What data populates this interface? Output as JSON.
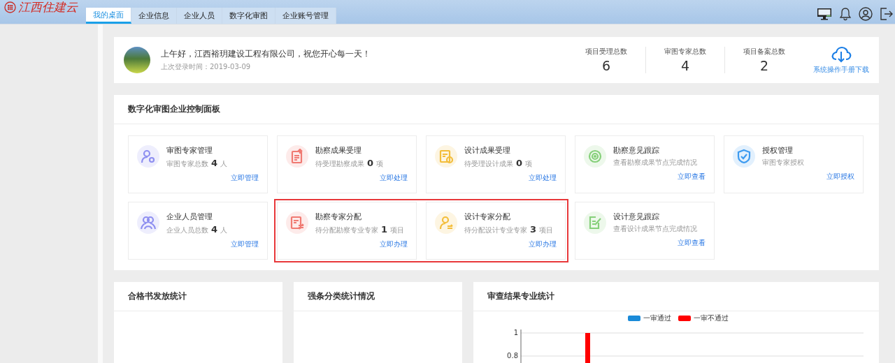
{
  "header": {
    "logo": "江西住建云",
    "tabs": [
      {
        "label": "我的桌面",
        "selected": true
      },
      {
        "label": "企业信息",
        "selected": false
      },
      {
        "label": "企业人员",
        "selected": false
      },
      {
        "label": "数字化审图",
        "selected": false
      },
      {
        "label": "企业账号管理",
        "selected": false
      }
    ]
  },
  "welcome": {
    "greeting": "上午好，江西裕玥建设工程有限公司，祝您开心每一天！",
    "last_login": "上次登录时间：2019-03-09",
    "stats": [
      {
        "label": "项目受理总数",
        "value": "6"
      },
      {
        "label": "审图专家总数",
        "value": "4"
      },
      {
        "label": "项目备案总数",
        "value": "2"
      }
    ],
    "download": "系统操作手册下载"
  },
  "control_panel": {
    "title": "数字化审图企业控制面板",
    "rows": [
      [
        {
          "kind": "person-gear",
          "color": "#8e8ff0",
          "title": "审图专家管理",
          "subtitle": "审图专家总数",
          "count": "4",
          "unit": "人",
          "action": "立即管理",
          "highlighted": false
        },
        {
          "kind": "doc-up",
          "color": "#f07a72",
          "title": "勘察成果受理",
          "subtitle": "待受理勘察成果",
          "count": "0",
          "unit": "项",
          "action": "立即处理",
          "highlighted": false
        },
        {
          "kind": "doc-clock",
          "color": "#f3bd3a",
          "title": "设计成果受理",
          "subtitle": "待受理设计成果",
          "count": "0",
          "unit": "项",
          "action": "立即处理",
          "highlighted": false
        },
        {
          "kind": "target",
          "color": "#86d07a",
          "title": "勘察意见跟踪",
          "subtitle": "查看勘察成果节点完成情况",
          "action": "立即查看",
          "highlighted": false
        },
        {
          "kind": "shield",
          "color": "#3d9bf0",
          "title": "授权管理",
          "subtitle": "审图专家授权",
          "action": "立即授权",
          "highlighted": false
        }
      ],
      [
        {
          "kind": "people",
          "color": "#8e8ff0",
          "title": "企业人员管理",
          "subtitle": "企业人员总数",
          "count": "4",
          "unit": "人",
          "action": "立即管理",
          "highlighted": false
        },
        {
          "kind": "doc-swap",
          "color": "#f07a72",
          "title": "勘察专家分配",
          "subtitle": "待分配勘察专业专家",
          "count": "1",
          "unit": "项目",
          "action": "立即办理",
          "highlighted": true
        },
        {
          "kind": "person-swap",
          "color": "#f3bd3a",
          "title": "设计专家分配",
          "subtitle": "待分配设计专业专家",
          "count": "3",
          "unit": "项目",
          "action": "立即办理",
          "highlighted": true
        },
        {
          "kind": "doc-edit",
          "color": "#86d07a",
          "title": "设计意见跟踪",
          "subtitle": "查看设计成果节点完成情况",
          "action": "立即查看",
          "highlighted": false
        }
      ]
    ]
  },
  "panels": [
    {
      "title": "合格书发放统计"
    },
    {
      "title": "强条分类统计情况"
    },
    {
      "title": "审查结果专业统计",
      "chart_data": {
        "type": "bar",
        "series": [
          {
            "name": "一审通过",
            "color": "#1a8ad8",
            "values": [
              null
            ]
          },
          {
            "name": "一审不通过",
            "color": "#ff0000",
            "values": [
              1
            ]
          }
        ],
        "ylim": [
          0,
          1
        ],
        "yticks": [
          0.8,
          1
        ]
      }
    }
  ]
}
